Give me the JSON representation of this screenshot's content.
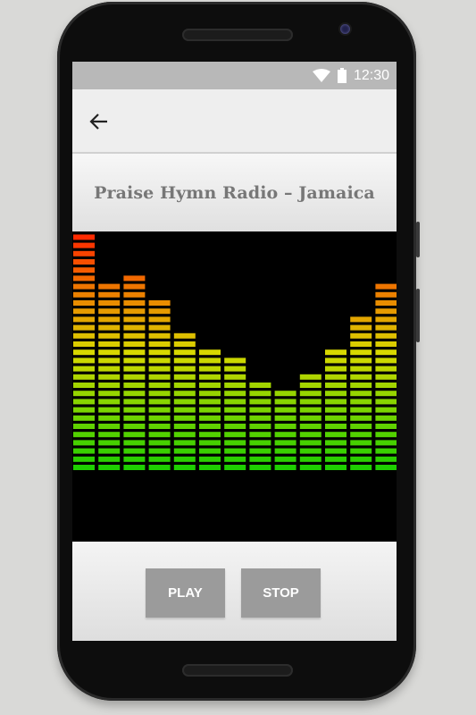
{
  "status_bar": {
    "time": "12:30",
    "icons": [
      "wifi-icon",
      "battery-icon"
    ]
  },
  "app_bar": {
    "back_icon": "arrow-left-icon"
  },
  "station": {
    "title": "Praise Hymn Radio – Jamaica"
  },
  "equalizer": {
    "max_segments": 29,
    "bar_levels": [
      29,
      23,
      24,
      21,
      17,
      15,
      14,
      11,
      10,
      12,
      15,
      19,
      23
    ],
    "colors": {
      "low": "#1ecf00",
      "mid": "#d8d800",
      "high": "#ff2a00"
    }
  },
  "controls": {
    "play_label": "PLAY",
    "stop_label": "STOP"
  }
}
